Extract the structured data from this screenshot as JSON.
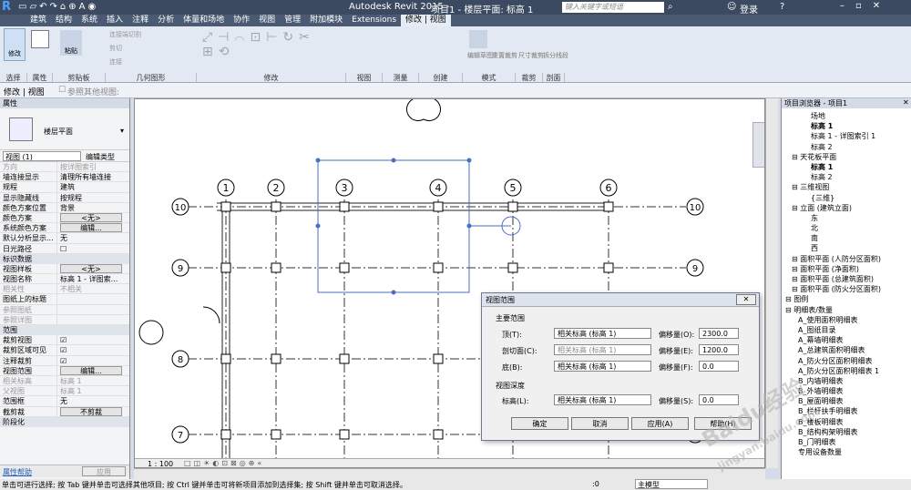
{
  "app": {
    "title": "Autodesk Revit 2015 -",
    "doc": "项目1 - 楼层平面: 标高 1",
    "search_placeholder": "键入关键字或短语",
    "login": "登录"
  },
  "menu": [
    "建筑",
    "结构",
    "系统",
    "插入",
    "注释",
    "分析",
    "体量和场地",
    "协作",
    "视图",
    "管理",
    "附加模块",
    "Extensions",
    "修改 | 视图"
  ],
  "ribbon": {
    "groups": [
      "选择",
      "属性",
      "剪贴板",
      "几何图形",
      "修改",
      "视图",
      "测量",
      "创建",
      "模式",
      "裁剪",
      "剖面"
    ],
    "select_label": "修改",
    "paste": "粘贴",
    "cut": "连接端切割",
    "cut2": "剪切",
    "join": "连接",
    "mode": [
      "编辑草图",
      "重置裁剪"
    ],
    "crop": "尺寸裁剪",
    "split": "拆分线段"
  },
  "optbar": {
    "label": "修改 | 视图",
    "checkbox": "参照其他视图:"
  },
  "props": {
    "header": "属性",
    "type": "楼层平面",
    "selector": "视图 (1)",
    "edit_type": "编辑类型",
    "rows": [
      [
        "方向",
        "按详图索引",
        "g"
      ],
      [
        "墙连接显示",
        "清理所有墙连接",
        ""
      ],
      [
        "规程",
        "建筑",
        ""
      ],
      [
        "显示隐藏线",
        "按规程",
        ""
      ],
      [
        "颜色方案位置",
        "背景",
        ""
      ],
      [
        "颜色方案",
        "<无>",
        "b"
      ],
      [
        "系统颜色方案",
        "编辑...",
        "b"
      ],
      [
        "默认分析显示...",
        "无",
        ""
      ],
      [
        "日光路径",
        "",
        "c"
      ]
    ],
    "sec1": "标识数据",
    "rows2": [
      [
        "视图样板",
        "<无>",
        "b"
      ],
      [
        "视图名称",
        "标高 1 - 详图索...",
        ""
      ],
      [
        "相关性",
        "不相关",
        "g"
      ],
      [
        "图纸上的标题",
        "",
        ""
      ],
      [
        "参照图纸",
        "",
        "g"
      ],
      [
        "参照详图",
        "",
        "g"
      ]
    ],
    "sec2": "范围",
    "rows3": [
      [
        "裁剪视图",
        "",
        "c"
      ],
      [
        "裁剪区域可见",
        "",
        "c"
      ],
      [
        "注释裁剪",
        "",
        "c"
      ],
      [
        "视图范围",
        "编辑...",
        "b"
      ],
      [
        "相关标高",
        "标高 1",
        "g"
      ],
      [
        "父视图",
        "标高 1",
        "g"
      ],
      [
        "范围框",
        "无",
        ""
      ],
      [
        "截剪裁",
        "不剪裁",
        "b"
      ]
    ],
    "sec3": "阶段化",
    "help": "属性帮助",
    "apply": "应用"
  },
  "browser": {
    "title": "项目浏览器 - 项目1",
    "items": [
      [
        4,
        "场地"
      ],
      [
        4,
        "标高 1"
      ],
      [
        4,
        "标高 1 - 详图索引 1"
      ],
      [
        4,
        "标高 2"
      ],
      [
        1,
        "天花板平面"
      ],
      [
        4,
        "标高 1"
      ],
      [
        4,
        "标高 2"
      ],
      [
        1,
        "三维视图"
      ],
      [
        4,
        "{三维}"
      ],
      [
        1,
        "立面 (建筑立面)"
      ],
      [
        4,
        "东"
      ],
      [
        4,
        "北"
      ],
      [
        4,
        "南"
      ],
      [
        4,
        "西"
      ],
      [
        1,
        "面积平面 (人防分区面积)"
      ],
      [
        1,
        "面积平面 (净面积)"
      ],
      [
        1,
        "面积平面 (总建筑面积)"
      ],
      [
        1,
        "面积平面 (防火分区面积)"
      ],
      [
        0,
        "图例"
      ],
      [
        0,
        "明细表/数量"
      ],
      [
        2,
        "A_使用面积明细表"
      ],
      [
        2,
        "A_图纸目录"
      ],
      [
        2,
        "A_幕墙明细表"
      ],
      [
        2,
        "A_总建筑面积明细表"
      ],
      [
        2,
        "A_防火分区面积明细表"
      ],
      [
        2,
        "A_防火分区面积明细表 1"
      ],
      [
        2,
        "B_内墙明细表"
      ],
      [
        2,
        "B_外墙明细表"
      ],
      [
        2,
        "B_屋面明细表"
      ],
      [
        2,
        "B_栏杆扶手明细表"
      ],
      [
        2,
        "B_楼板明细表"
      ],
      [
        2,
        "B_结构构架明细表"
      ],
      [
        2,
        "B_门明细表"
      ],
      [
        2,
        "专用设备数量"
      ]
    ]
  },
  "grids": {
    "cols": [
      "1",
      "2",
      "3",
      "4",
      "5",
      "6"
    ],
    "rows": [
      "10",
      "9",
      "8",
      "7"
    ]
  },
  "dialog": {
    "title": "视图范围",
    "main": "主要范围",
    "top": "顶(T):",
    "cut": "剖切面(C):",
    "bottom": "底(B):",
    "level": "相关标高 (标高 1)",
    "offset_o": "偏移量(O):",
    "offset_e": "偏移量(E):",
    "offset_f": "偏移量(F):",
    "offset_s": "偏移量(S):",
    "v_top": "2300.0",
    "v_cut": "1200.0",
    "v_bot": "0.0",
    "depth": "视图深度",
    "lvl": "标高(L):",
    "v_lvl": "0.0",
    "ok": "确定",
    "cancel": "取消",
    "apply": "应用(A)",
    "help": "帮助(H)"
  },
  "canvas": {
    "scale": "1 : 100",
    "model": "主模型",
    "zero": ":0"
  },
  "status": "单击可进行选择; 按 Tab 键并单击可选择其他项目; 按 Ctrl 键并单击可将新项目添加到选择集; 按 Shift 键并单击可取消选择。",
  "watermark": [
    "Baidu经验",
    "jingyan.baidu.com"
  ]
}
